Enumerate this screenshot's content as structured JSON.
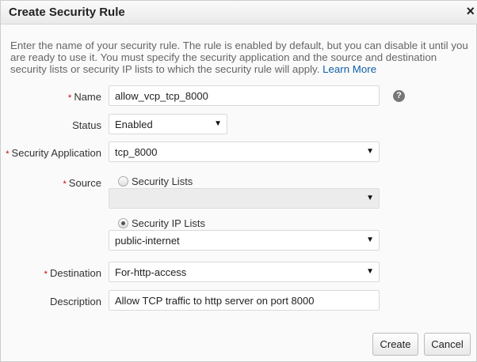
{
  "dialog": {
    "title": "Create Security Rule",
    "close_icon": "×"
  },
  "intro": {
    "text": "Enter the name of your security rule. The rule is enabled by default, but you can disable it until you are ready to use it. You must specify the security application and the source and destination security lists or security IP lists to which the security rule will apply. ",
    "link": "Learn More"
  },
  "form": {
    "name": {
      "label": "Name",
      "value": "allow_vcp_tcp_8000",
      "help": "?"
    },
    "status": {
      "label": "Status",
      "value": "Enabled"
    },
    "security_application": {
      "label": "Security Application",
      "value": "tcp_8000"
    },
    "source": {
      "label": "Source",
      "option_lists": "Security Lists",
      "lists_value": "",
      "option_ip_lists": "Security IP Lists",
      "ip_lists_value": "public-internet",
      "selected": "Security IP Lists"
    },
    "destination": {
      "label": "Destination",
      "value": "For-http-access"
    },
    "description": {
      "label": "Description",
      "value": "Allow TCP traffic to http server on port 8000"
    },
    "required_mark": "*",
    "arrow": "▼"
  },
  "buttons": {
    "create": "Create",
    "cancel": "Cancel"
  }
}
